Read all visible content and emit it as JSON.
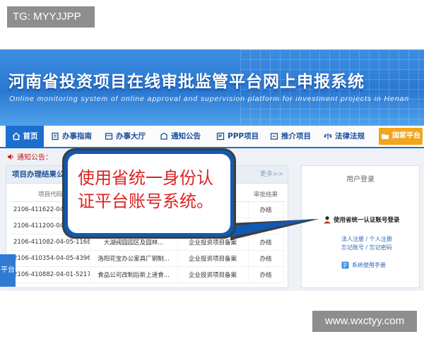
{
  "overlay_tag": "TG: MYYJJPP",
  "watermark": "www.wxctyy.com",
  "banner": {
    "title": "河南省投资项目在线审批监管平台网上申报系统",
    "subtitle": "Online monitoring system of online approval and supervision platform for investment projects in Henan"
  },
  "nav": {
    "items": [
      {
        "label": "首页",
        "icon": "home-icon"
      },
      {
        "label": "办事指南",
        "icon": "guide-icon"
      },
      {
        "label": "办事大厅",
        "icon": "hall-icon"
      },
      {
        "label": "通知公告",
        "icon": "notice-icon"
      },
      {
        "label": "PPP项目",
        "icon": "ppp-icon"
      },
      {
        "label": "推介项目",
        "icon": "promo-icon"
      },
      {
        "label": "法律法规",
        "icon": "law-icon"
      }
    ],
    "national_label": "国家平台"
  },
  "notice": {
    "label": "通知公告："
  },
  "results": {
    "title": "项目办理结果公",
    "more": "更多>>",
    "columns": [
      "项目代码",
      "",
      "",
      "审批结果"
    ],
    "rows": [
      {
        "code": "2106-411622-04-0",
        "name": "",
        "type": "",
        "result": "办结"
      },
      {
        "code": "2106-411200-04-0",
        "name": "",
        "type": "",
        "result": "办结"
      },
      {
        "code": "2106-411082-04-05-116842",
        "name": "大湖阀园园区及园林...",
        "type": "企业投资项目备案",
        "result": "办结"
      },
      {
        "code": "2106-410354-04-05-439676",
        "name": "洛阳花宝办公家具厂钢制...",
        "type": "企业投资项目备案",
        "result": "办结"
      },
      {
        "code": "2106-410882-04-01-521716",
        "name": "食品公司改制后新上速食...",
        "type": "企业投资项目备案",
        "result": "办结"
      }
    ]
  },
  "login": {
    "title": "用户登录",
    "unified_login": "使用省统一认证账号登录",
    "links_row1": "法人注册 / 个人注册",
    "links_row2": "忘记账号 / 忘记密码",
    "manual": "系统使用手册"
  },
  "left_tab": "平台",
  "callout": {
    "text": "使用省统一身份认证平台账号系统。"
  },
  "colors": {
    "brand_blue": "#1d6fcd",
    "national_orange": "#f3a51b",
    "callout_red": "#dd2222",
    "callout_border": "#0f5ab4"
  }
}
